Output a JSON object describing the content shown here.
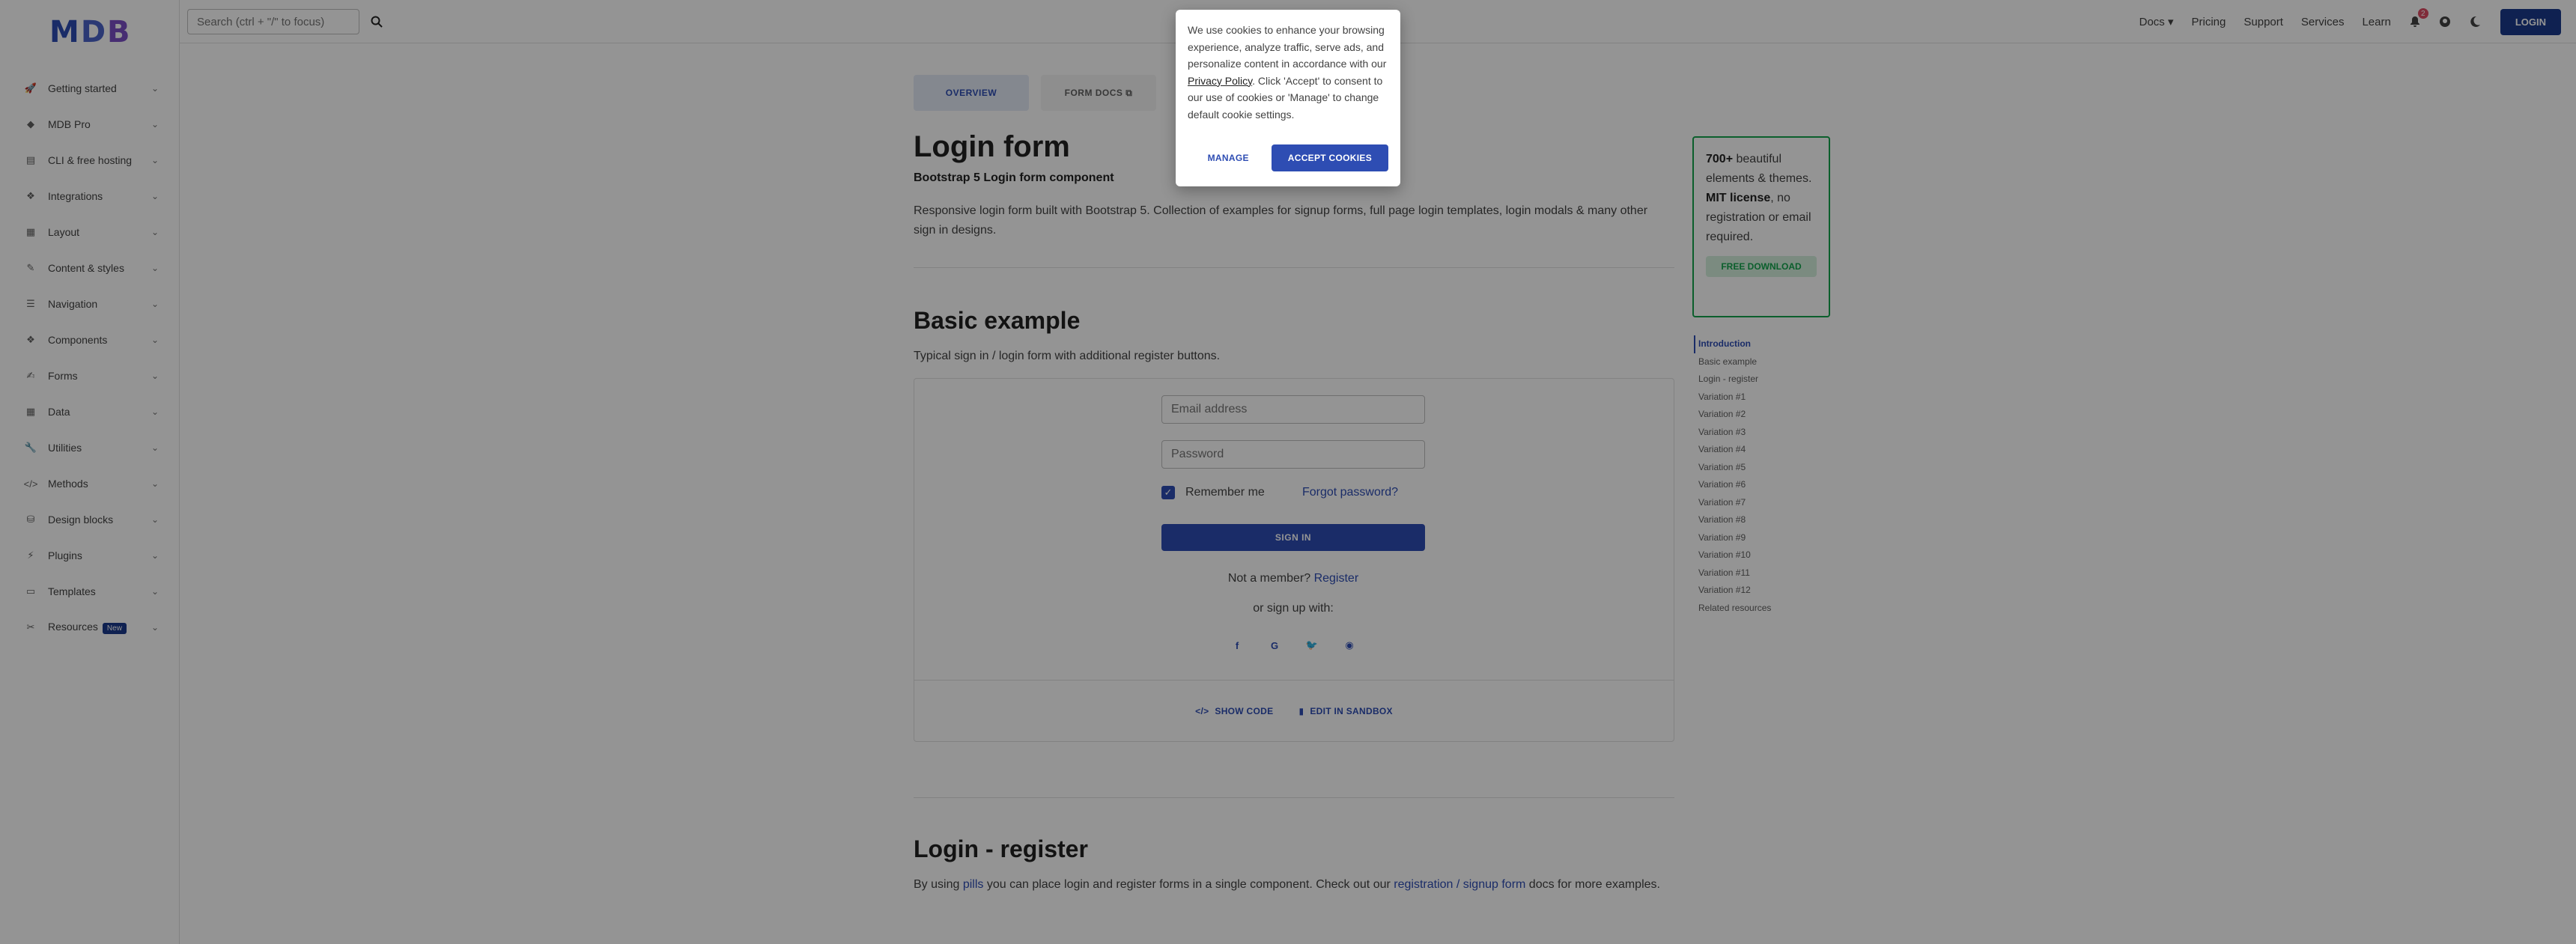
{
  "logo": {
    "m": "M",
    "d": "D",
    "b": "B"
  },
  "sidebar": {
    "items": [
      {
        "label": "Getting started",
        "icon": "rocket-icon"
      },
      {
        "label": "MDB Pro",
        "icon": "gem-icon"
      },
      {
        "label": "CLI & free hosting",
        "icon": "server-icon"
      },
      {
        "label": "Integrations",
        "icon": "cubes-icon"
      },
      {
        "label": "Layout",
        "icon": "table-icon"
      },
      {
        "label": "Content & styles",
        "icon": "pencil-icon"
      },
      {
        "label": "Navigation",
        "icon": "bars-icon"
      },
      {
        "label": "Components",
        "icon": "cubes-icon"
      },
      {
        "label": "Forms",
        "icon": "edit-icon"
      },
      {
        "label": "Data",
        "icon": "table-icon"
      },
      {
        "label": "Utilities",
        "icon": "wrench-icon"
      },
      {
        "label": "Methods",
        "icon": "code-icon"
      },
      {
        "label": "Design blocks",
        "icon": "database-icon"
      },
      {
        "label": "Plugins",
        "icon": "plug-icon"
      },
      {
        "label": "Templates",
        "icon": "window-icon"
      },
      {
        "label": "Resources",
        "icon": "tools-icon",
        "badge": "New"
      }
    ]
  },
  "topbar": {
    "search_placeholder": "Search (ctrl + \"/\" to focus)",
    "links": [
      "Docs",
      "Pricing",
      "Support",
      "Services",
      "Learn"
    ],
    "notifications": "2",
    "login_label": "LOGIN"
  },
  "main": {
    "tabs": [
      "OVERVIEW",
      "FORM DOCS"
    ],
    "title": "Login form",
    "subtitle": "Bootstrap 5 Login form component",
    "lead": "Responsive login form built with Bootstrap 5. Collection of examples for signup forms, full page login templates, login modals & many other sign in designs.",
    "basic": {
      "heading": "Basic example",
      "desc": "Typical sign in / login form with additional register buttons.",
      "email_placeholder": "Email address",
      "password_placeholder": "Password",
      "remember_label": "Remember me",
      "forgot_label": "Forgot password?",
      "signin_label": "SIGN IN",
      "not_member": "Not a member?",
      "register_label": "Register",
      "signup_with": "or sign up with:",
      "show_code": "SHOW CODE",
      "edit_sandbox": "EDIT IN SANDBOX"
    },
    "login_register": {
      "heading": "Login - register",
      "desc_1": "By using",
      "desc_link1": "pills",
      "desc_2": "you can place login and register forms in a single component. Check out our",
      "desc_link2": "registration / signup form",
      "desc_3": "docs for more examples."
    }
  },
  "promo": {
    "count": "700+",
    "text1": "beautiful elements & themes.",
    "license": "MIT license",
    "text2": ", no registration or email required.",
    "button": "FREE DOWNLOAD"
  },
  "toc": [
    "Introduction",
    "Basic example",
    "Login - register",
    "Variation #1",
    "Variation #2",
    "Variation #3",
    "Variation #4",
    "Variation #5",
    "Variation #6",
    "Variation #7",
    "Variation #8",
    "Variation #9",
    "Variation #10",
    "Variation #11",
    "Variation #12",
    "Related resources"
  ],
  "cookie": {
    "text_1": "We use cookies to enhance your browsing experience, analyze traffic, serve ads, and personalize content in accordance with our",
    "policy_link": "Privacy Policy",
    "text_2": ". Click 'Accept' to consent to our use of cookies or 'Manage' to change default cookie settings.",
    "manage_label": "MANAGE",
    "accept_label": "ACCEPT COOKIES"
  },
  "colors": {
    "primary": "#2e4db3",
    "navy": "#1b3a8c",
    "success": "#14a44d",
    "danger": "#dc4c64"
  }
}
